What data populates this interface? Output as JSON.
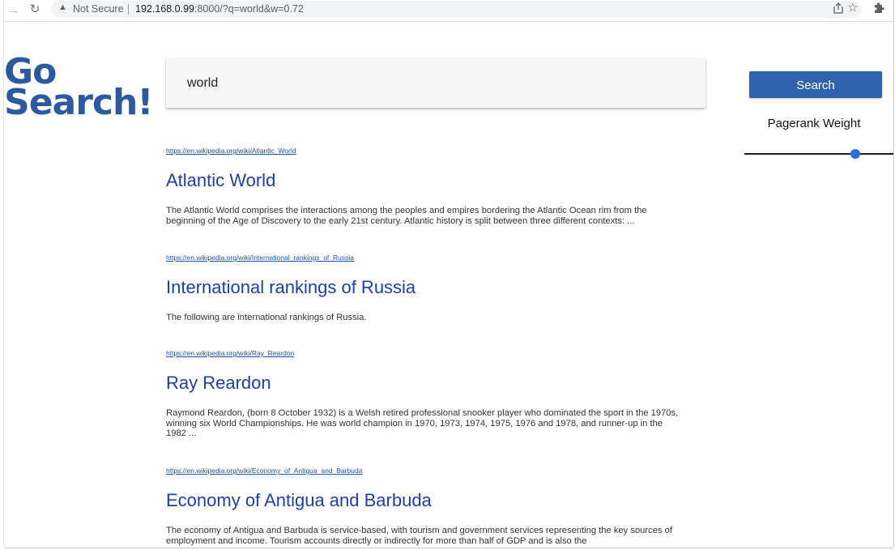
{
  "browser": {
    "security_label": "Not Secure",
    "url_host": "192.168.0.99",
    "url_rest": ":8000/?q=world&w=0.72"
  },
  "icons": {
    "forward": "arrow-right",
    "reload": "reload",
    "warning": "warning-triangle",
    "share": "share",
    "bookmark": "star",
    "extensions": "puzzle-piece"
  },
  "logo": {
    "line1": "Go",
    "line2": "Search!"
  },
  "search": {
    "query": "world",
    "button_label": "Search"
  },
  "pagerank": {
    "label": "Pagerank Weight",
    "value": 0.72
  },
  "results": [
    {
      "url": "https://en.wikipedia.org/wiki/Atlantic_World",
      "title": "Atlantic World",
      "snippet": "The Atlantic World comprises the interactions among the peoples and empires bordering the Atlantic Ocean rim from the beginning of the Age of Discovery to the early 21st century. Atlantic history is split between three different contexts: ..."
    },
    {
      "url": "https://en.wikipedia.org/wiki/International_rankings_of_Russia",
      "title": "International rankings of Russia",
      "snippet": "The following are international rankings of Russia."
    },
    {
      "url": "https://en.wikipedia.org/wiki/Ray_Reardon",
      "title": "Ray Reardon",
      "snippet": "Raymond Reardon, (born 8 October 1932) is a Welsh retired professional snooker player who dominated the sport in the 1970s, winning six World Championships. He was world champion in 1970, 1973, 1974, 1975, 1976 and 1978, and runner-up in the 1982 ..."
    },
    {
      "url": "https://en.wikipedia.org/wiki/Economy_of_Antigua_and_Barbuda",
      "title": "Economy of Antigua and Barbuda",
      "snippet": "The economy of Antigua and Barbuda is service-based, with tourism and government services representing the key sources of employment and income. Tourism accounts directly or indirectly for more than half of GDP and is also the"
    }
  ],
  "colors": {
    "logo": "#2c5aa0",
    "button": "#2f63ad",
    "result_title": "#1d3fa6",
    "result_url": "#1a55b5",
    "slider_thumb": "#2f6be0"
  }
}
